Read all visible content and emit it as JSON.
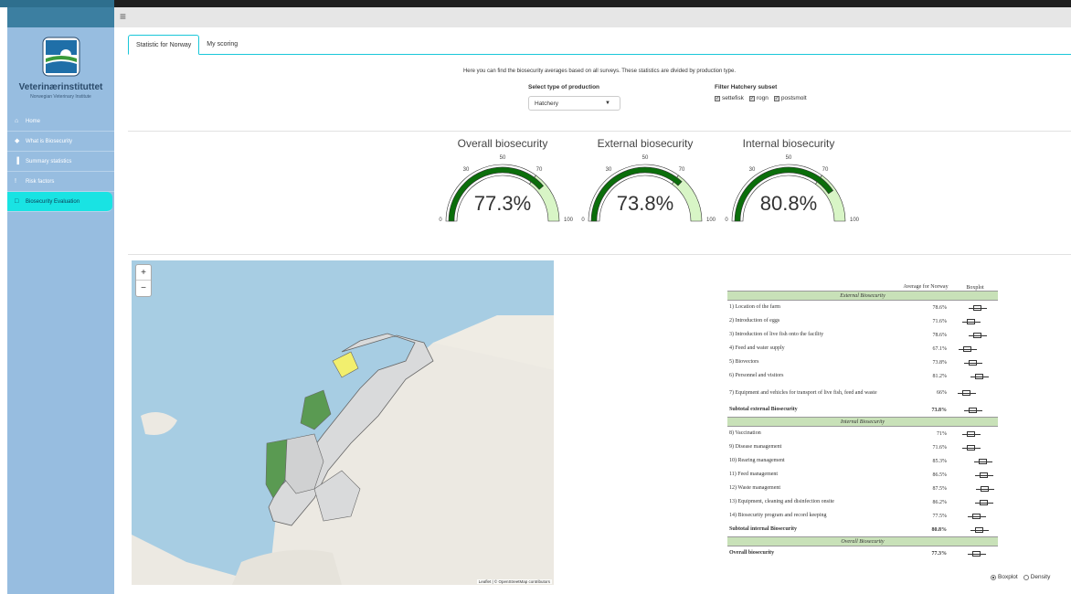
{
  "app": {
    "logo_name": "Veterinærinstituttet",
    "logo_sub": "Norwegian Veterinary Institute",
    "menu_icon": "hamburger-icon"
  },
  "sidebar": {
    "items": [
      {
        "label": "Home",
        "icon": "home-icon",
        "glyph": "⌂",
        "active": false
      },
      {
        "label": "What is Biosecurity",
        "icon": "shield-icon",
        "glyph": "◆",
        "active": false
      },
      {
        "label": "Summary statistics",
        "icon": "bar-chart-icon",
        "glyph": "▐",
        "active": false
      },
      {
        "label": "Risk factors",
        "icon": "exclamation-icon",
        "glyph": "!",
        "active": false
      },
      {
        "label": "Biosecurity Evaluation",
        "icon": "clipboard-icon",
        "glyph": "□",
        "active": true
      }
    ]
  },
  "tabs": [
    {
      "label": "Statistic for Norway",
      "active": true
    },
    {
      "label": "My scoring",
      "active": false
    }
  ],
  "intro_text": "Here you can find the biosecurity averages based on all surveys. These statistics are divided by production type.",
  "production_select": {
    "label": "Select type of production",
    "value": "Hatchery"
  },
  "hatchery_filter": {
    "label": "Filter Hatchery subset",
    "options": [
      {
        "label": "settefisk",
        "checked": true
      },
      {
        "label": "rogn",
        "checked": true
      },
      {
        "label": "postsmolt",
        "checked": true
      }
    ]
  },
  "gauges": [
    {
      "title": "Overall biosecurity",
      "value": 77.3,
      "display": "77.3%",
      "min": 0,
      "max": 100,
      "ticks": [
        "0",
        "30",
        "50",
        "70",
        "100"
      ]
    },
    {
      "title": "External biosecurity",
      "value": 73.8,
      "display": "73.8%",
      "min": 0,
      "max": 100,
      "ticks": [
        "0",
        "30",
        "50",
        "70",
        "100"
      ]
    },
    {
      "title": "Internal biosecurity",
      "value": 80.8,
      "display": "80.8%",
      "min": 0,
      "max": 100,
      "ticks": [
        "0",
        "30",
        "50",
        "70",
        "100"
      ]
    }
  ],
  "gauge_colors": {
    "fill": "#0b6e0b",
    "band_high": "#d8f5c6",
    "band_low": "#ffffff",
    "outline": "#333333"
  },
  "map": {
    "zoom_in": "+",
    "zoom_out": "−",
    "attribution": "Leaflet | © OpenStreetMap contributors"
  },
  "table": {
    "col_avg": "Average for Norway",
    "col_box": "Boxplot",
    "sections": [
      {
        "title": "External Biosecurity",
        "rows": [
          {
            "label": "1) Location of the farm",
            "value": "78.6%"
          },
          {
            "label": "2) Introduction of eggs",
            "value": "71.6%"
          },
          {
            "label": "3) Introduction of live fish onto the facility",
            "value": "78.6%"
          },
          {
            "label": "4) Feed and water supply",
            "value": "67.1%"
          },
          {
            "label": "5) Biovectors",
            "value": "73.8%"
          },
          {
            "label": "6) Personnel and visitors",
            "value": "81.2%"
          },
          {
            "label": "7) Equipment and vehicles for transport of live fish, feed and waste",
            "value": "66%"
          },
          {
            "label": "Subtotal external Biosecurity",
            "value": "73.8%",
            "bold": true
          }
        ]
      },
      {
        "title": "Internal Biosecurity",
        "rows": [
          {
            "label": "8) Vaccination",
            "value": "71%"
          },
          {
            "label": "9) Disease management",
            "value": "71.6%"
          },
          {
            "label": "10) Rearing management",
            "value": "85.3%"
          },
          {
            "label": "11) Feed management",
            "value": "86.5%"
          },
          {
            "label": "12) Waste management",
            "value": "87.5%"
          },
          {
            "label": "13) Equipment, cleaning and disinfection onsite",
            "value": "86.2%"
          },
          {
            "label": "14) Biosecurity program and record keeping",
            "value": "77.5%"
          },
          {
            "label": "Subtotal internal Biosecurity",
            "value": "80.8%",
            "bold": true
          }
        ]
      },
      {
        "title": "Overall Biosecurity",
        "rows": [
          {
            "label": "Overall biosecurity",
            "value": "77.3%",
            "bold": true
          }
        ]
      }
    ]
  },
  "view_toggle": {
    "options": [
      {
        "label": "Boxplot",
        "selected": true
      },
      {
        "label": "Density",
        "selected": false
      }
    ]
  }
}
